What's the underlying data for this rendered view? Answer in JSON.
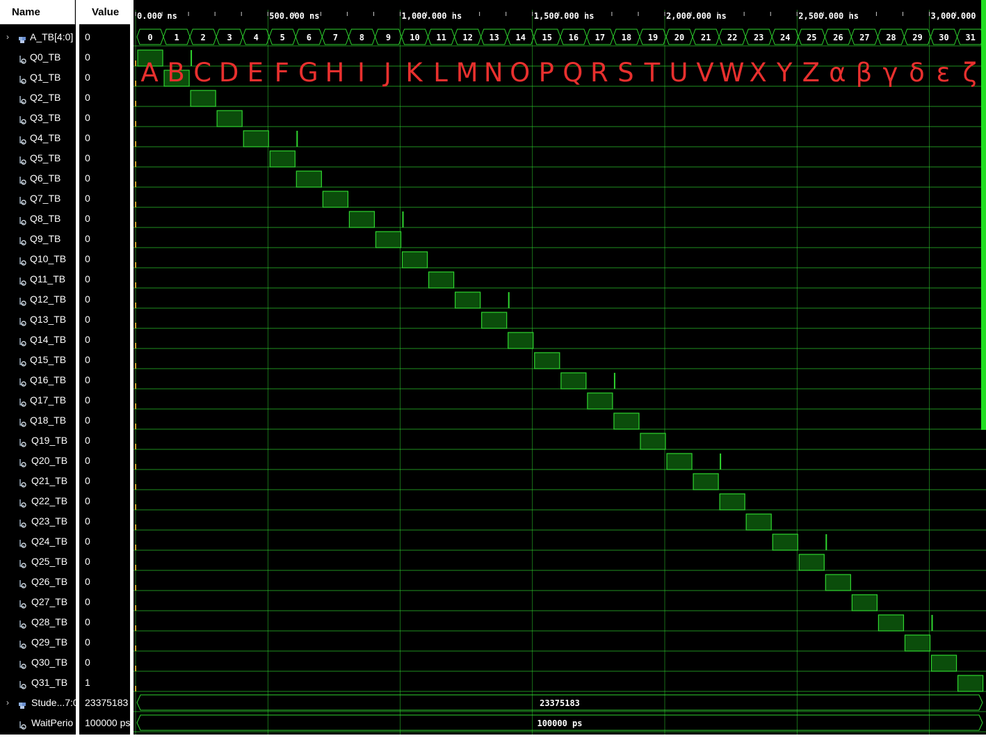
{
  "headers": {
    "name": "Name",
    "value": "Value"
  },
  "timeline": {
    "unit": "ns",
    "ticks": [
      "0.000 ns",
      "500.000 ns",
      "1,000.000 ns",
      "1,500.000 ns",
      "2,000.000 ns",
      "2,500.000 ns",
      "3,000.000"
    ]
  },
  "bus_signal": {
    "name": "A_TB[4:0]",
    "value": "0",
    "segments": [
      "0",
      "1",
      "2",
      "3",
      "4",
      "5",
      "6",
      "7",
      "8",
      "9",
      "10",
      "11",
      "12",
      "13",
      "14",
      "15",
      "16",
      "17",
      "18",
      "19",
      "20",
      "21",
      "22",
      "23",
      "24",
      "25",
      "26",
      "27",
      "28",
      "29",
      "30",
      "31"
    ]
  },
  "signals": [
    {
      "name": "Q0_TB",
      "value": "0"
    },
    {
      "name": "Q1_TB",
      "value": "0"
    },
    {
      "name": "Q2_TB",
      "value": "0"
    },
    {
      "name": "Q3_TB",
      "value": "0"
    },
    {
      "name": "Q4_TB",
      "value": "0"
    },
    {
      "name": "Q5_TB",
      "value": "0"
    },
    {
      "name": "Q6_TB",
      "value": "0"
    },
    {
      "name": "Q7_TB",
      "value": "0"
    },
    {
      "name": "Q8_TB",
      "value": "0"
    },
    {
      "name": "Q9_TB",
      "value": "0"
    },
    {
      "name": "Q10_TB",
      "value": "0"
    },
    {
      "name": "Q11_TB",
      "value": "0"
    },
    {
      "name": "Q12_TB",
      "value": "0"
    },
    {
      "name": "Q13_TB",
      "value": "0"
    },
    {
      "name": "Q14_TB",
      "value": "0"
    },
    {
      "name": "Q15_TB",
      "value": "0"
    },
    {
      "name": "Q16_TB",
      "value": "0"
    },
    {
      "name": "Q17_TB",
      "value": "0"
    },
    {
      "name": "Q18_TB",
      "value": "0"
    },
    {
      "name": "Q19_TB",
      "value": "0"
    },
    {
      "name": "Q20_TB",
      "value": "0"
    },
    {
      "name": "Q21_TB",
      "value": "0"
    },
    {
      "name": "Q22_TB",
      "value": "0"
    },
    {
      "name": "Q23_TB",
      "value": "0"
    },
    {
      "name": "Q24_TB",
      "value": "0"
    },
    {
      "name": "Q25_TB",
      "value": "0"
    },
    {
      "name": "Q26_TB",
      "value": "0"
    },
    {
      "name": "Q27_TB",
      "value": "0"
    },
    {
      "name": "Q28_TB",
      "value": "0"
    },
    {
      "name": "Q29_TB",
      "value": "0"
    },
    {
      "name": "Q30_TB",
      "value": "0"
    },
    {
      "name": "Q31_TB",
      "value": "1"
    }
  ],
  "student_id": {
    "name": "Stude...7:0",
    "value": "23375183",
    "wave_label": "23375183"
  },
  "wait_period": {
    "name": "WaitPerio",
    "value": "100000 ps",
    "wave_label": "100000 ps"
  },
  "annotation_letters": [
    "A",
    "B",
    "C",
    "D",
    "E",
    "F",
    "G",
    "H",
    "I",
    "J",
    "K",
    "L",
    "M",
    "N",
    "O",
    "P",
    "Q",
    "R",
    "S",
    "T",
    "U",
    "V",
    "W",
    "X",
    "Y",
    "Z",
    "α",
    "β",
    "γ",
    "δ",
    "ε",
    "ζ"
  ],
  "colors": {
    "wave": "#2fd52f",
    "wave_fill": "#0b4d0b",
    "annotation": "#e8302e",
    "background": "#000000",
    "grid": "#2fd52f"
  }
}
